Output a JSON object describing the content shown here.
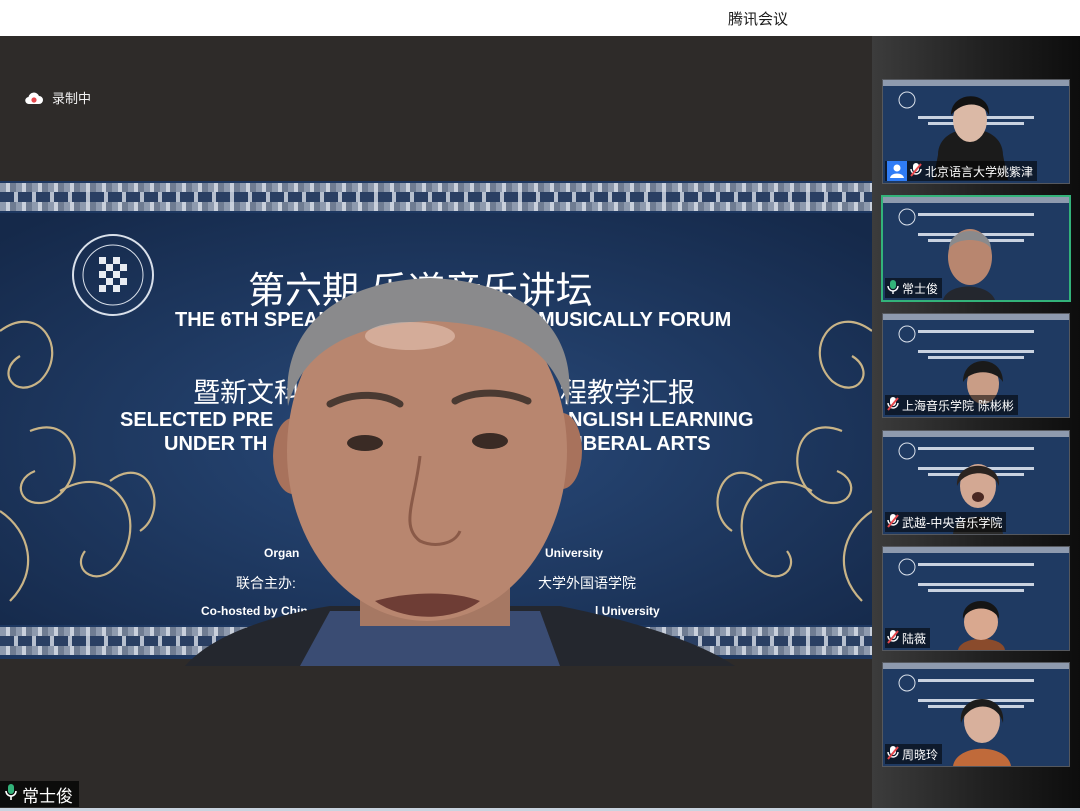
{
  "app": {
    "title": "腾讯会议"
  },
  "recording": {
    "label": "录制中"
  },
  "slide": {
    "title_cn": "第六期  乐道音乐讲坛",
    "title_en": "THE 6TH SPEAK",
    "title_en_right": "MUSICALLY FORUM",
    "subtitle_cn_left": "暨新文科",
    "subtitle_cn_right": "程教学汇报",
    "line1_left": "SELECTED PRE",
    "line1_right": "NGLISH LEARNING",
    "line2_left": "UNDER TH",
    "line2_right": "LIBERAL ARTS",
    "org_left": "Organ",
    "org_right": "University",
    "cohost_cn_left": "联合主办:",
    "cohost_cn_right": "大学外国语学院",
    "cohost_en_left": "Co-hosted by Chin",
    "cohost_en_right": "l University"
  },
  "main_speaker": {
    "name": "常士俊",
    "mic": "on"
  },
  "participants": [
    {
      "name": "北京语言大学姚紫津",
      "mic": "muted",
      "has_avatar_badge": true
    },
    {
      "name": "常士俊",
      "mic": "on",
      "active": true
    },
    {
      "name": "上海音乐学院 陈彬彬",
      "mic": "muted"
    },
    {
      "name": "武越-中央音乐学院",
      "mic": "muted"
    },
    {
      "name": "陆薇",
      "mic": "muted"
    },
    {
      "name": "周晓玲",
      "mic": "muted"
    }
  ],
  "mini_slide": {
    "title_cn": "第六期  乐道音乐讲坛",
    "title_en": "THE 6TH SPEAKING ENGLISH MUSICALLY FORUM"
  },
  "colors": {
    "accent_green": "#33b37a",
    "mute_red": "#e5484d",
    "slide_navy": "#1d3760"
  }
}
